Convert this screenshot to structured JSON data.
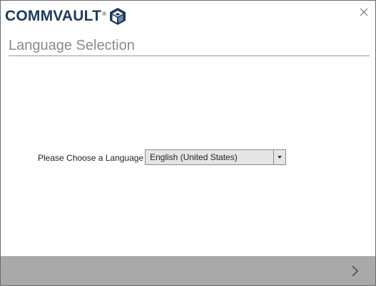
{
  "header": {
    "logo_text": "COMMVAULT",
    "logo_tm": "®"
  },
  "page": {
    "title": "Language Selection"
  },
  "language": {
    "label": "Please Choose a Language",
    "selected": "English (United States)"
  },
  "icons": {
    "logo": "commvault-cube-icon",
    "close": "close-icon",
    "dropdown": "dropdown-arrow-icon",
    "next": "chevron-right-icon"
  },
  "colors": {
    "brand": "#1d3a5c",
    "footer": "#a9a9a9",
    "title": "#8a8a8a"
  }
}
